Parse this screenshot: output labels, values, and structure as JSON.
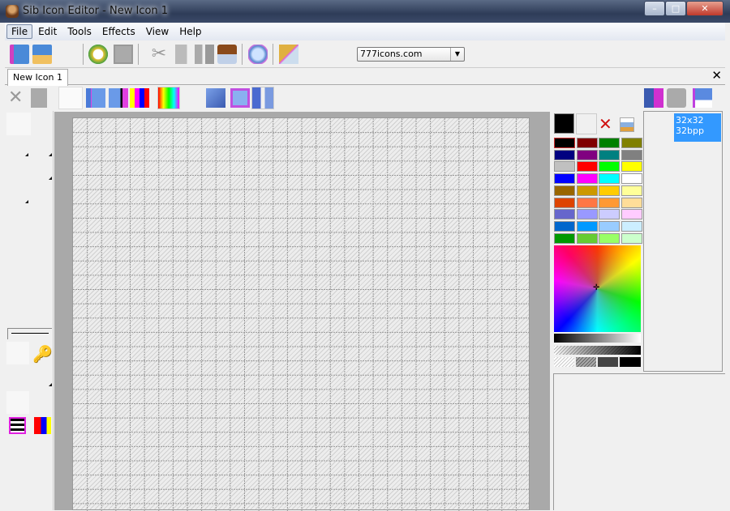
{
  "window": {
    "title": "Sib Icon Editor - New Icon 1",
    "min": "–",
    "max": "□",
    "close": "✕"
  },
  "menu": [
    {
      "label": "File"
    },
    {
      "label": "Edit"
    },
    {
      "label": "Tools"
    },
    {
      "label": "Effects"
    },
    {
      "label": "View"
    },
    {
      "label": "Help"
    }
  ],
  "toolbar": {
    "site_select": "777icons.com"
  },
  "tabs": [
    {
      "label": "New Icon 1"
    }
  ],
  "close_doc": "✕",
  "palette": {
    "colors": [
      "#000000",
      "#800000",
      "#008000",
      "#808000",
      "#000080",
      "#800080",
      "#008080",
      "#808080",
      "#c0c0c0",
      "#ff0000",
      "#00ff00",
      "#ffff00",
      "#0000ff",
      "#ff00ff",
      "#00ffff",
      "#ffffff",
      "#996600",
      "#cc9900",
      "#ffcc00",
      "#ffff99",
      "#dd4400",
      "#ff7744",
      "#ff9933",
      "#ffdd99",
      "#6666cc",
      "#9999ff",
      "#ccccff",
      "#ffccff",
      "#0066cc",
      "#0099ff",
      "#99ccff",
      "#cceeff",
      "#009900",
      "#66cc33",
      "#99ff66",
      "#ccffcc"
    ],
    "primary": "#000000",
    "secondary": "#f0f0f0"
  },
  "formats": [
    {
      "size": "32x32",
      "depth": "32bpp"
    }
  ],
  "canvas": {
    "grid_cols": 32,
    "grid_rows": 32
  }
}
